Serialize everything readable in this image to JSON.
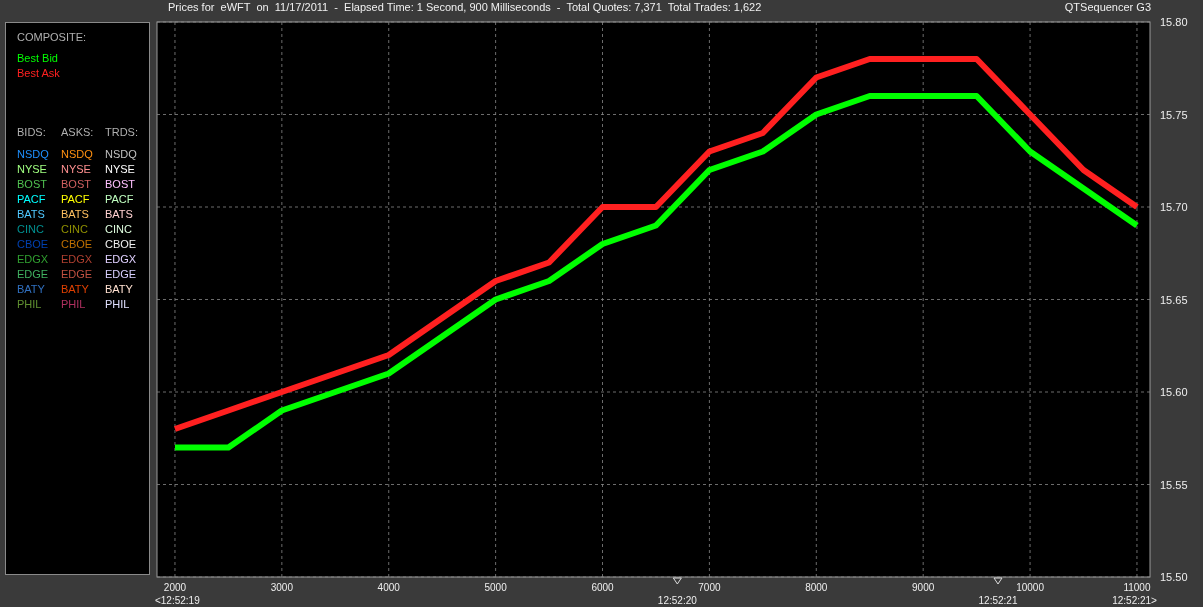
{
  "title_bar": {
    "title": "Prices for  eWFT  on  11/17/2011  -  Elapsed Time: 1 Second, 900 Milliseconds  -  Total Quotes: 7,371  Total Trades: 1,622",
    "app_name": "QTSequencer G3"
  },
  "legend": {
    "composite_title": "COMPOSITE:",
    "columns": [
      {
        "header": "BIDS:",
        "items": [
          {
            "label": "NSDQ",
            "color": "#1e90ff"
          },
          {
            "label": "NYSE",
            "color": "#a0ff80"
          },
          {
            "label": "BOST",
            "color": "#50c050"
          },
          {
            "label": "PACF",
            "color": "#00ffff"
          },
          {
            "label": "BATS",
            "color": "#50c8ff"
          },
          {
            "label": "CINC",
            "color": "#009090"
          },
          {
            "label": "CBOE",
            "color": "#0040b0"
          },
          {
            "label": "EDGX",
            "color": "#30a030"
          },
          {
            "label": "EDGE",
            "color": "#40b060"
          },
          {
            "label": "BATY",
            "color": "#3070c0"
          },
          {
            "label": "PHIL",
            "color": "#609030"
          }
        ]
      },
      {
        "header": "ASKS:",
        "items": [
          {
            "label": "NSDQ",
            "color": "#ff9010"
          },
          {
            "label": "NYSE",
            "color": "#ff9090"
          },
          {
            "label": "BOST",
            "color": "#d06060"
          },
          {
            "label": "PACF",
            "color": "#ffff00"
          },
          {
            "label": "BATS",
            "color": "#ffc060"
          },
          {
            "label": "CINC",
            "color": "#909000"
          },
          {
            "label": "CBOE",
            "color": "#c07000"
          },
          {
            "label": "EDGX",
            "color": "#b04030"
          },
          {
            "label": "EDGE",
            "color": "#c05040"
          },
          {
            "label": "BATY",
            "color": "#e04000"
          },
          {
            "label": "PHIL",
            "color": "#b03060"
          }
        ]
      },
      {
        "header": "TRDS:",
        "items": [
          {
            "label": "NSDQ",
            "color": "#c0c0c0"
          },
          {
            "label": "NYSE",
            "color": "#ffffff"
          },
          {
            "label": "BOST",
            "color": "#ffc0ff"
          },
          {
            "label": "PACF",
            "color": "#c0ffc0"
          },
          {
            "label": "BATS",
            "color": "#ffd0d0"
          },
          {
            "label": "CINC",
            "color": "#e0ffe0"
          },
          {
            "label": "CBOE",
            "color": "#f0f0f0"
          },
          {
            "label": "EDGX",
            "color": "#e0d0ff"
          },
          {
            "label": "EDGE",
            "color": "#d8d0ff"
          },
          {
            "label": "BATY",
            "color": "#ffe0d0"
          },
          {
            "label": "PHIL",
            "color": "#e0e0ff"
          }
        ]
      }
    ]
  },
  "chart": {
    "chart_data": {
      "type": "line",
      "x": [
        2000,
        2500,
        3000,
        3500,
        4000,
        4500,
        5000,
        5500,
        6000,
        6500,
        7000,
        7500,
        8000,
        8500,
        9000,
        9500,
        10000,
        10500,
        11000
      ],
      "series": [
        {
          "name": "Best Bid",
          "color": "#00ff00",
          "values": [
            15.57,
            15.57,
            15.59,
            15.6,
            15.61,
            15.63,
            15.65,
            15.66,
            15.68,
            15.69,
            15.72,
            15.73,
            15.75,
            15.76,
            15.76,
            15.76,
            15.73,
            15.71,
            15.69
          ]
        },
        {
          "name": "Best Ask",
          "color": "#ff2020",
          "values": [
            15.58,
            15.59,
            15.6,
            15.61,
            15.62,
            15.64,
            15.66,
            15.67,
            15.7,
            15.7,
            15.73,
            15.74,
            15.77,
            15.78,
            15.78,
            15.78,
            15.75,
            15.72,
            15.7
          ]
        }
      ],
      "grid": true,
      "xlim": [
        1832,
        11122
      ],
      "ylim": [
        15.5,
        15.8
      ],
      "xticks": [
        2000,
        3000,
        4000,
        5000,
        6000,
        7000,
        8000,
        9000,
        10000,
        11000
      ],
      "yticks": [
        {
          "value": 15.5,
          "label": "15.50"
        },
        {
          "value": 15.55,
          "label": "15.55"
        },
        {
          "value": 15.6,
          "label": "15.60"
        },
        {
          "value": 15.65,
          "label": "15.65"
        },
        {
          "value": 15.7,
          "label": "15.70"
        },
        {
          "value": 15.75,
          "label": "15.75"
        },
        {
          "value": 15.8,
          "label": "15.80"
        }
      ]
    },
    "time_labels": [
      "<12:52:19",
      "12:52:20",
      "12:52:21",
      "12:52:21>"
    ]
  }
}
